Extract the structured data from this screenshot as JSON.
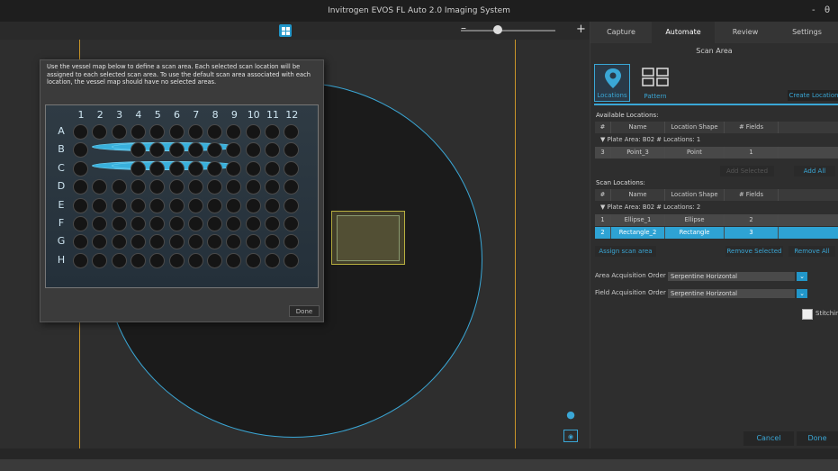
{
  "window": {
    "title": "Invitrogen EVOS FL Auto 2.0 Imaging System",
    "controls": [
      "-",
      "θ"
    ]
  },
  "toolbar": {
    "zoom_minus": "–",
    "zoom_plus": "+"
  },
  "popup": {
    "message": "Use the vessel map below to define a scan area.  Each selected scan location will be assigned to each selected scan area.  To use the default scan area associated with each location, the vessel map should have no selected areas.",
    "columns": [
      "1",
      "2",
      "3",
      "4",
      "5",
      "6",
      "7",
      "8",
      "9",
      "10",
      "11",
      "12"
    ],
    "rows": [
      "A",
      "B",
      "C",
      "D",
      "E",
      "F",
      "G",
      "H"
    ],
    "selected_wells": [
      "B2",
      "B3",
      "C2",
      "C3"
    ],
    "done_label": "Done"
  },
  "tabs": [
    "Capture",
    "Automate",
    "Review",
    "Settings"
  ],
  "active_tab": "Automate",
  "scan_area": {
    "header": "Scan Area",
    "locations_label": "Locations",
    "pattern_label": "Pattern",
    "create_location": "Create Location",
    "available_label": "Available Locations:",
    "table_headers": [
      "#",
      "Name",
      "Location Shape",
      "# Fields"
    ],
    "available_group": "Plate  Area: B02   # Locations: 1",
    "available_rows": [
      {
        "n": "3",
        "name": "Point_3",
        "shape": "Point",
        "fields": "1"
      }
    ],
    "add_selected": "Add Selected",
    "add_all": "Add All",
    "scan_label": "Scan Locations:",
    "scan_group": "Plate  Area: B02   # Locations: 2",
    "scan_rows": [
      {
        "n": "1",
        "name": "Ellipse_1",
        "shape": "Ellipse",
        "fields": "2"
      },
      {
        "n": "2",
        "name": "Rectangle_2",
        "shape": "Rectangle",
        "fields": "3"
      }
    ],
    "assign_scan_area": "Assign scan area",
    "remove_selected": "Remove Selected",
    "remove_all": "Remove All",
    "area_order_label": "Area Acquisition Order",
    "area_order_value": "Serpentine Horizontal",
    "field_order_label": "Field Acquisition Order",
    "field_order_value": "Serpentine Horizontal",
    "stitching_label": "Stitching",
    "cancel": "Cancel",
    "done": "Done"
  },
  "colors": {
    "accent": "#3aa7d6",
    "vessel_border": "#c89428",
    "selected_well": "#39b0dc"
  }
}
